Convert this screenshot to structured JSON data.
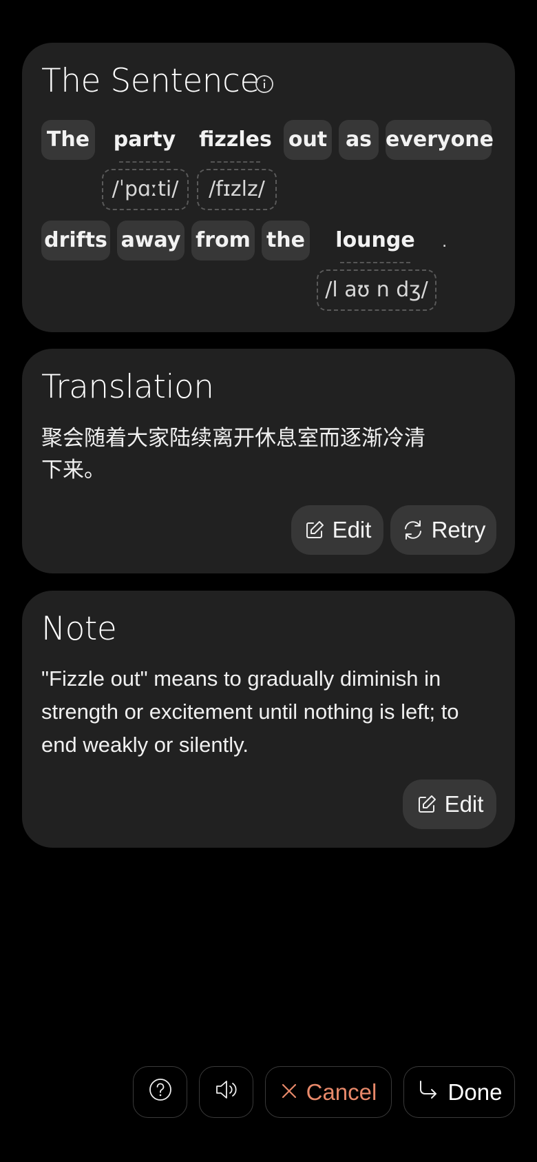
{
  "sentence_card": {
    "title": "The Sentence",
    "info_icon": "info-icon",
    "words": [
      {
        "text": "The"
      },
      {
        "text": "party",
        "phonetic": "/ˈpɑːti/"
      },
      {
        "text": "fizzles",
        "phonetic": "/fɪzlz/"
      },
      {
        "text": "out"
      },
      {
        "text": "as"
      },
      {
        "text": "everyone"
      },
      {
        "text": "drifts"
      },
      {
        "text": "away"
      },
      {
        "text": "from"
      },
      {
        "text": "the"
      },
      {
        "text": "lounge",
        "phonetic": "/l aʊ n dʒ/"
      }
    ],
    "punctuation": "."
  },
  "translation_card": {
    "title": "Translation",
    "text_line1": "聚会随着大家陆续离开休息室而逐渐冷清",
    "text_line2": "下来。",
    "edit_label": "Edit",
    "retry_label": "Retry",
    "edit_icon": "edit-icon",
    "retry_icon": "refresh-icon"
  },
  "note_card": {
    "title": "Note",
    "text_line1": "\"Fizzle out\" means to gradually diminish in",
    "text_line2": "strength or excitement until nothing is left; to",
    "text_line3": "end weakly or silently.",
    "edit_label": "Edit",
    "edit_icon": "edit-icon"
  },
  "bottom_bar": {
    "help_icon": "help-circle-icon",
    "speaker_icon": "speaker-icon",
    "cancel_label": "Cancel",
    "done_label": "Done",
    "accent_color": "#e8896a"
  }
}
